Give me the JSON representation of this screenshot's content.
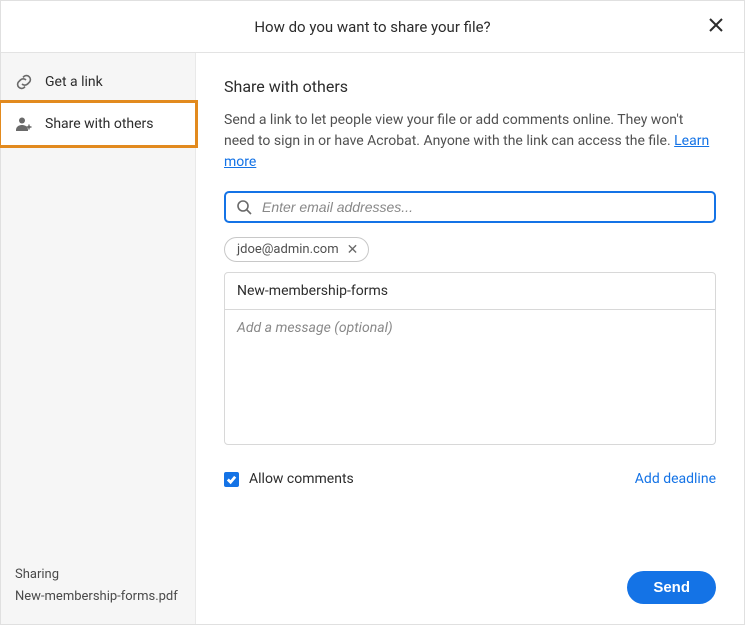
{
  "header": {
    "title": "How do you want to share your file?"
  },
  "sidebar": {
    "items": [
      {
        "label": "Get a link",
        "icon": "link-icon",
        "active": false
      },
      {
        "label": "Share with others",
        "icon": "people-add-icon",
        "active": true
      }
    ],
    "footer_label": "Sharing",
    "footer_filename": "New-membership-forms.pdf"
  },
  "main": {
    "title": "Share with others",
    "description_part1": "Send a link to let people view your file or add comments online. They won't need to sign in or have Acrobat. Anyone with the link can access the file. ",
    "learn_more_label": "Learn more",
    "email_placeholder": "Enter email addresses...",
    "recipients": [
      {
        "email": "jdoe@admin.com"
      }
    ],
    "subject": "New-membership-forms",
    "message_placeholder": "Add a message (optional)",
    "allow_comments_label": "Allow comments",
    "allow_comments_checked": true,
    "add_deadline_label": "Add deadline",
    "send_label": "Send"
  }
}
